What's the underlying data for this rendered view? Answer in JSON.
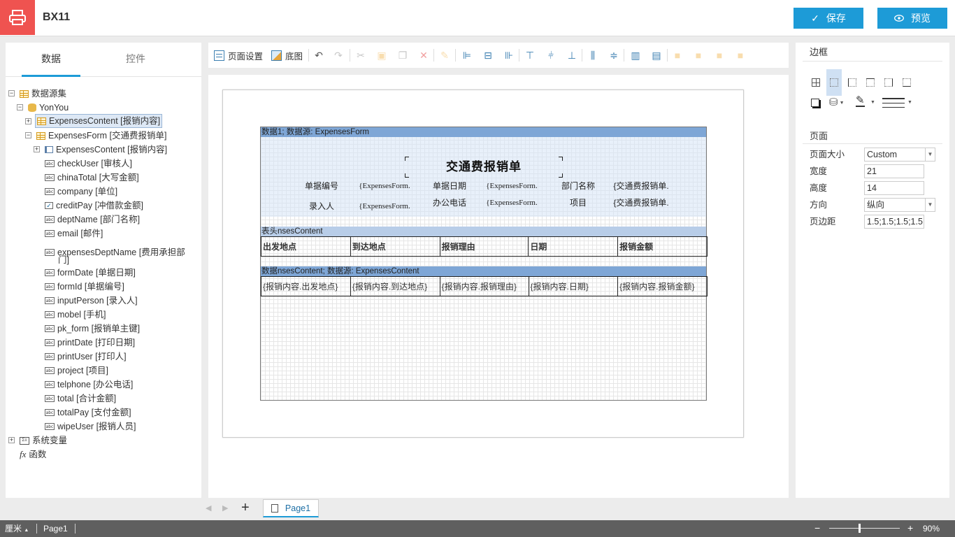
{
  "app": {
    "title": "BX11",
    "save_label": "保存",
    "preview_label": "预览",
    "accent": "#1d9bd7",
    "logo_color": "#ef5350"
  },
  "left": {
    "tabs": [
      "数据",
      "控件"
    ],
    "tree": {
      "root": "数据源集",
      "source": "YonYou",
      "expenses_content": "ExpensesContent [报销内容]",
      "expenses_form": "ExpensesForm [交通费报销单]",
      "sub_content": "ExpensesContent [报销内容]",
      "fields": [
        "checkUser [审核人]",
        "chinaTotal [大写金额]",
        "company [单位]",
        "creditPay [冲借款金额]",
        "deptName [部门名称]",
        "email [邮件]",
        "expensesDeptName [费用承担部",
        "门]",
        "formDate [单据日期]",
        "formId [单据编号]",
        "inputPerson [录入人]",
        "mobel [手机]",
        "pk_form [报销单主键]",
        "printDate [打印日期]",
        "printUser [打印人]",
        "project [项目]",
        "telphone [办公电话]",
        "total [合计金额]",
        "totalPay [支付金额]",
        "wipeUser [报销人员]"
      ],
      "sys_vars": "系统变量",
      "functions": "函数"
    }
  },
  "toolbar": {
    "page_setup": "页面设置",
    "background": "底图"
  },
  "report": {
    "band1": "数据1; 数据源: ExpensesForm",
    "title": "交通费报销单",
    "row1": [
      "单据编号",
      "{ExpensesForm.",
      "单据日期",
      "{ExpensesForm.",
      "部门名称",
      "{交通费报销单."
    ],
    "row2": [
      "录入人",
      "{ExpensesForm.",
      "办公电话",
      "{ExpensesForm.",
      "项目",
      "{交通费报销单."
    ],
    "band2": "表头nsesContent",
    "headers": [
      "出发地点",
      "到达地点",
      "报销理由",
      "日期",
      "报销金额"
    ],
    "band3": "数据nsesContent; 数据源: ExpensesContent",
    "cells": [
      "{报销内容.出发地点}",
      "{报销内容.到达地点}",
      "{报销内容.报销理由}",
      "{报销内容.日期}",
      "{报销内容.报销金额}"
    ]
  },
  "right": {
    "border_title": "边框",
    "page_title": "页面",
    "page_size_label": "页面大小",
    "page_size_value": "Custom",
    "width_label": "宽度",
    "width_value": "21",
    "height_label": "高度",
    "height_value": "14",
    "orientation_label": "方向",
    "orientation_value": "纵向",
    "margin_label": "页边距",
    "margin_value": "1.5;1.5;1.5;1.5"
  },
  "pages": {
    "tab": "Page1"
  },
  "status": {
    "unit": "厘米",
    "page": "Page1",
    "zoom": "90%",
    "zoom_level": 0.53
  }
}
